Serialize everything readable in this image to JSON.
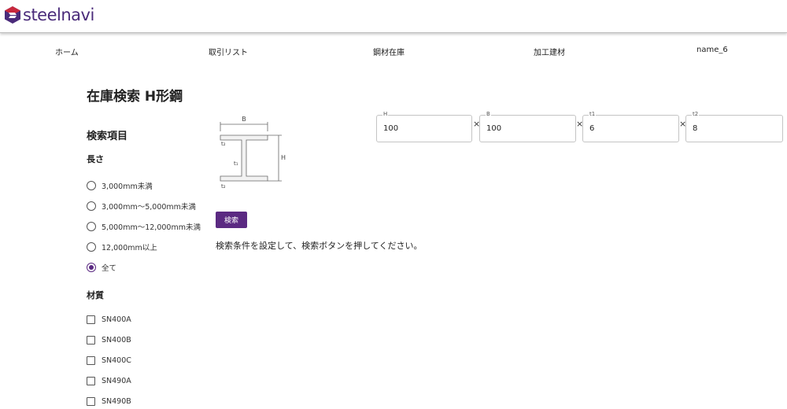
{
  "header": {
    "logo_text": "steelnavi"
  },
  "nav": [
    {
      "label": "ホーム"
    },
    {
      "label": "取引リスト"
    },
    {
      "label": "鋼材在庫"
    },
    {
      "label": "加工建材"
    },
    {
      "label": "name_6"
    }
  ],
  "page": {
    "title": "在庫検索 H形鋼",
    "section_title": "検索項目"
  },
  "length_group": {
    "label": "長さ",
    "options": [
      {
        "label": "3,000mm未満",
        "checked": false
      },
      {
        "label": "3,000mm〜5,000mm未満",
        "checked": false
      },
      {
        "label": "5,000mm〜12,000mm未満",
        "checked": false
      },
      {
        "label": "12,000mm以上",
        "checked": false
      },
      {
        "label": "全て",
        "checked": true
      }
    ]
  },
  "material_group": {
    "label": "材質",
    "options": [
      {
        "label": "SN400A",
        "checked": false
      },
      {
        "label": "SN400B",
        "checked": false
      },
      {
        "label": "SN400C",
        "checked": false
      },
      {
        "label": "SN490A",
        "checked": false
      },
      {
        "label": "SN490B",
        "checked": false
      }
    ]
  },
  "diagram": {
    "b": "B",
    "h": "H",
    "t1": "t₁",
    "t2_top": "t₂",
    "t2_bottom": "t₂"
  },
  "dimensions": [
    {
      "label": "H",
      "value": "100"
    },
    {
      "label": "B",
      "value": "100"
    },
    {
      "label": "t1",
      "value": "6"
    },
    {
      "label": "t2",
      "value": "8"
    }
  ],
  "times_symbol": "×",
  "search_button": "検索",
  "message": "検索条件を設定して、検索ボタンを押してください。",
  "colors": {
    "accent": "#5b2a82",
    "logo_text": "#4a2b7a",
    "logo_red": "#c8283c",
    "logo_purple": "#4a2b7a"
  }
}
